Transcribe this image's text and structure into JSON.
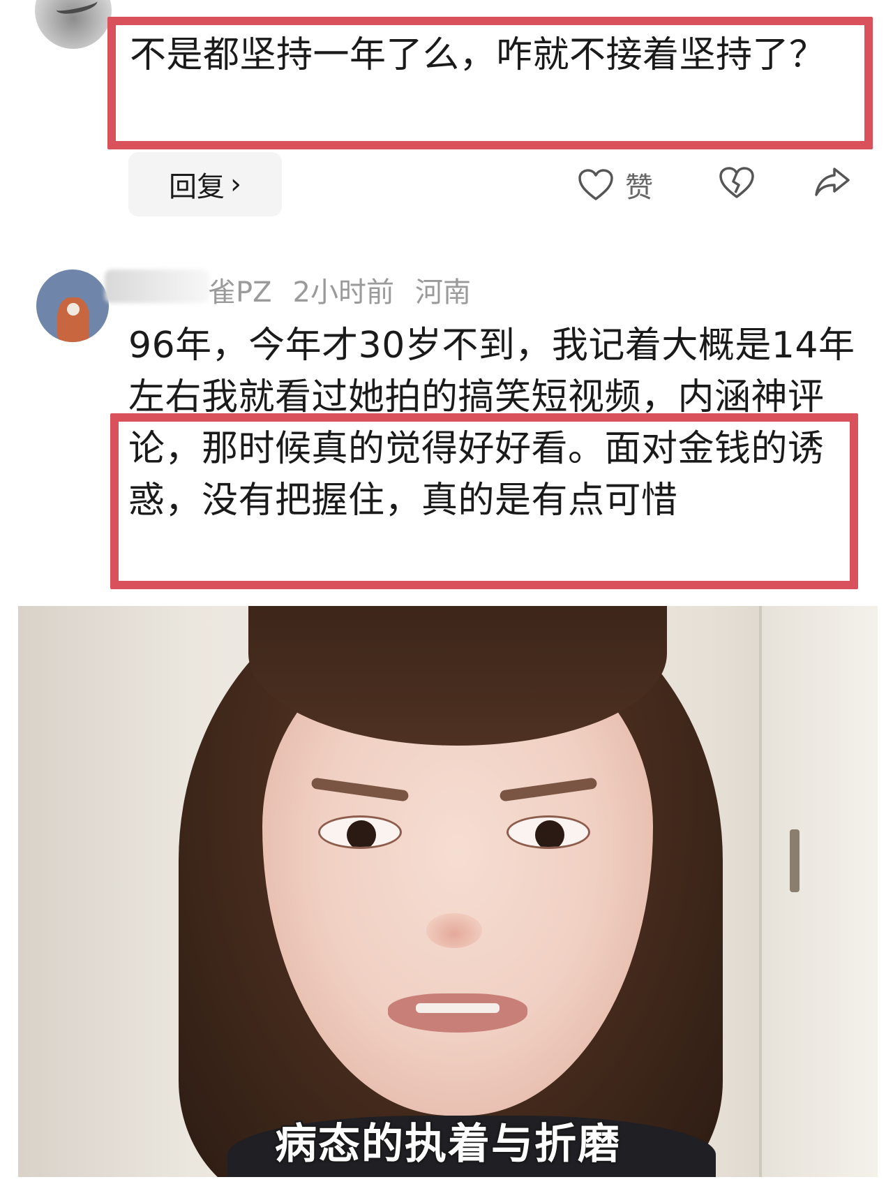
{
  "comment1": {
    "text": "不是都坚持一年了么，咋就不接着坚持了？",
    "reply_label": "回复",
    "reply_chevron": "›",
    "like_label": "赞",
    "icons": [
      "heart-icon",
      "broken-heart-icon",
      "share-arrow-icon"
    ]
  },
  "comment2": {
    "username": "雀PZ",
    "time": "2小时前",
    "location": "河南",
    "text": "96年，今年才30岁不到，我记着大概是14年左右我就看过她拍的搞笑短视频，内涵神评论，那时候真的觉得好好看。面对金钱的诱惑，没有把握住，真的是有点可惜"
  },
  "photo": {
    "caption": "病态的执着与折磨"
  },
  "colors": {
    "highlight_box": "#d9515a",
    "meta_text": "#9a9a9a",
    "reply_bg": "#f4f4f4"
  }
}
